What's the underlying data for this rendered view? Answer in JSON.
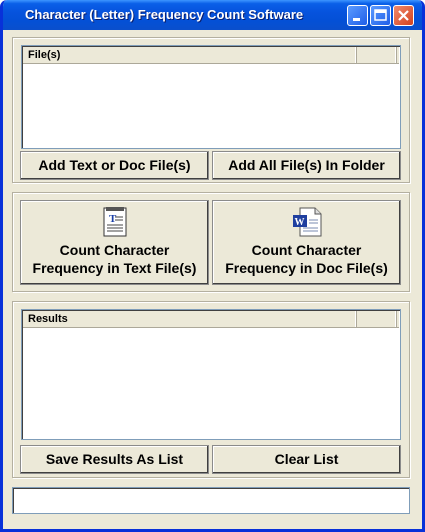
{
  "window": {
    "title": "Character (Letter) Frequency Count Software"
  },
  "files": {
    "header_label": "File(s)",
    "add_text_button": "Add Text or Doc File(s)",
    "add_folder_button": "Add All File(s) In Folder"
  },
  "count": {
    "text_button_line1": "Count Character",
    "text_button_line2": "Frequency in Text File(s)",
    "doc_button_line1": "Count Character",
    "doc_button_line2": "Frequency in Doc File(s)",
    "text_icon": "text-document-icon",
    "doc_icon": "word-document-icon"
  },
  "results": {
    "header_label": "Results",
    "save_button": "Save Results As List",
    "clear_button": "Clear List"
  },
  "status_text": "",
  "colors": {
    "titlebar": "#0653dd",
    "window_bg": "#ece9d8",
    "border": "#0831d9"
  }
}
